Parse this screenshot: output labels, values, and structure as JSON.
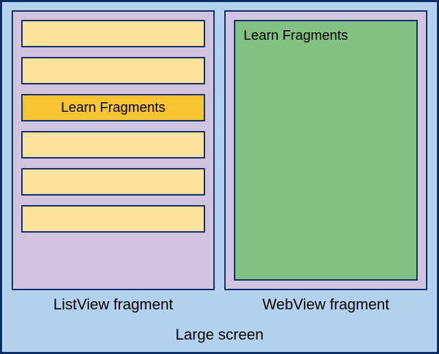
{
  "screen_label": "Large screen",
  "listview": {
    "label": "ListView fragment",
    "items": [
      {
        "label": "",
        "selected": false
      },
      {
        "label": "",
        "selected": false
      },
      {
        "label": "Learn Fragments",
        "selected": true
      },
      {
        "label": "",
        "selected": false
      },
      {
        "label": "",
        "selected": false
      },
      {
        "label": "",
        "selected": false
      }
    ]
  },
  "webview": {
    "label": "WebView fragment",
    "content_title": "Learn Fragments"
  }
}
